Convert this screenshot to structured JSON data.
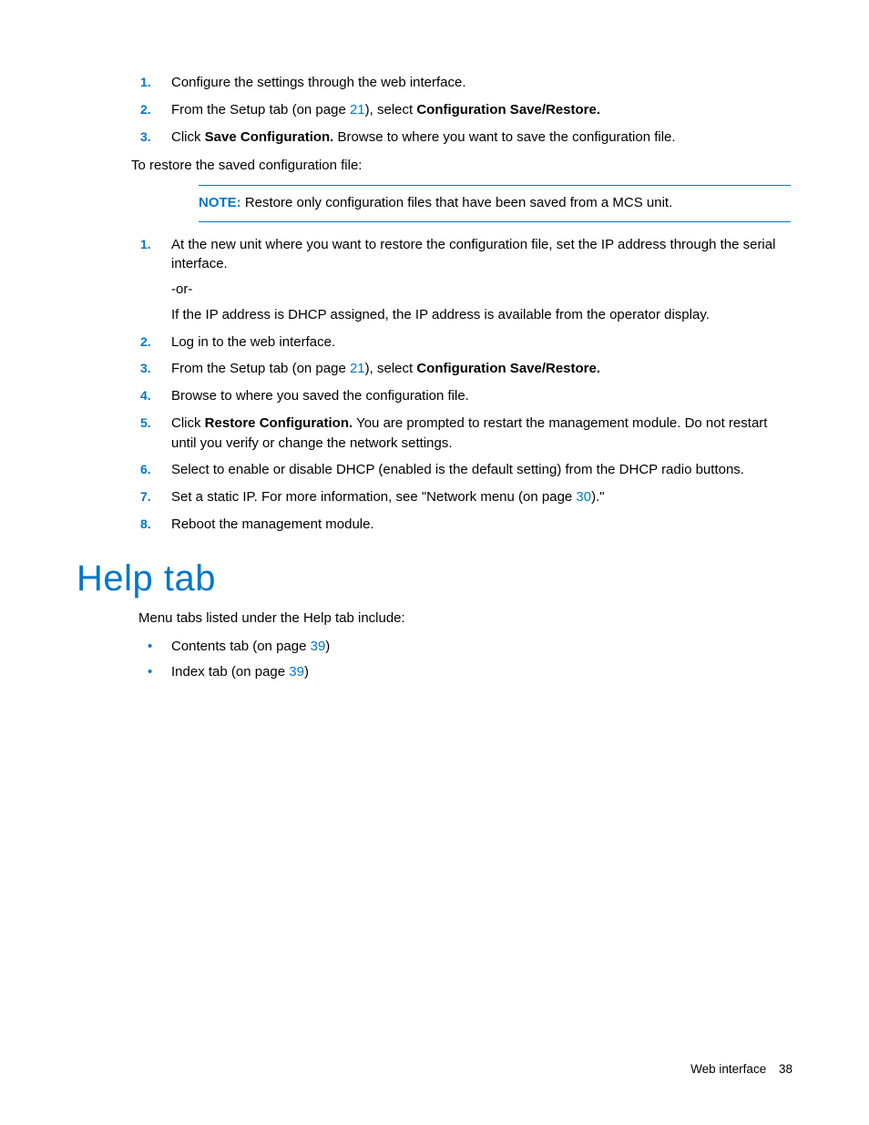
{
  "list1": {
    "items": [
      {
        "num": "1.",
        "text": "Configure the settings through the web interface."
      },
      {
        "num": "2.",
        "pre": "From the Setup tab (on page ",
        "link": "21",
        "post": "), select ",
        "bold": "Configuration Save/Restore."
      },
      {
        "num": "3.",
        "pre": "Click ",
        "bold": "Save Configuration.",
        "post": " Browse to where you want to save the configuration file."
      }
    ]
  },
  "restore_intro": "To restore the saved configuration file:",
  "note": {
    "label": "NOTE:",
    "text": "  Restore only configuration files that have been saved from a MCS unit."
  },
  "list2": {
    "items": [
      {
        "num": "1.",
        "text": "At the new unit where you want to restore the configuration file, set the IP address through the serial interface.",
        "sub1": "-or-",
        "sub2": "If the IP address is DHCP assigned, the IP address is available from the operator display."
      },
      {
        "num": "2.",
        "text": "Log in to the web interface."
      },
      {
        "num": "3.",
        "pre": "From the Setup tab (on page ",
        "link": "21",
        "post": "), select ",
        "bold": "Configuration Save/Restore."
      },
      {
        "num": "4.",
        "text": "Browse to where you saved the configuration file."
      },
      {
        "num": "5.",
        "pre": "Click ",
        "bold": "Restore Configuration.",
        "post": " You are prompted to restart the management module. Do not restart until you verify or change the network settings."
      },
      {
        "num": "6.",
        "text": "Select to enable or disable DHCP (enabled is the default setting) from the DHCP radio buttons."
      },
      {
        "num": "7.",
        "pre": "Set a static IP. For more information, see \"Network menu (on page ",
        "link": "30",
        "post": ").\""
      },
      {
        "num": "8.",
        "text": "Reboot the management module."
      }
    ]
  },
  "heading": "Help tab",
  "help_intro": "Menu tabs listed under the Help tab include:",
  "bullets": [
    {
      "pre": "Contents tab (on page ",
      "link": "39",
      "post": ")"
    },
    {
      "pre": "Index tab (on page ",
      "link": "39",
      "post": ")"
    }
  ],
  "footer": {
    "section": "Web interface",
    "page": "38"
  }
}
